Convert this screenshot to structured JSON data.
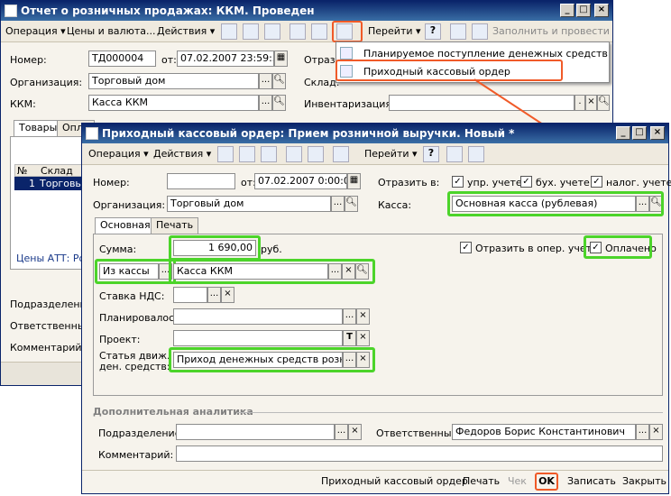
{
  "back": {
    "title": "Отчет о розничных продажах: ККМ. Проведен",
    "toolbar": {
      "operation": "Операция",
      "prices": "Цены и валюта...",
      "actions": "Действия",
      "goto": "Перейти",
      "fill": "Заполнить и провести"
    },
    "number_label": "Номер:",
    "number": "ТД000004",
    "from_label": "от:",
    "date": "07.02.2007 23:59:59",
    "org_label": "Организация:",
    "org": "Торговый дом",
    "kkm_label": "ККМ:",
    "kkm": "Касса ККМ",
    "reflect_label": "Отрази",
    "warehouse_label": "Склад:",
    "inventory_label": "Инвентаризация:",
    "tabs": [
      "Товары",
      "Опла"
    ],
    "col_no": "№",
    "col_wh": "Склад",
    "row_no": "1",
    "row_wh": "Торговы",
    "prices_att": "Цены АТТ: Розн",
    "dept_label": "Подразделение",
    "resp_label": "Ответственный",
    "comment_label": "Комментарий:"
  },
  "menu": {
    "items": [
      "Планируемое поступление денежных средств",
      "Приходный кассовый ордер"
    ]
  },
  "front": {
    "title": "Приходный кассовый ордер: Прием розничной выручки. Новый *",
    "toolbar": {
      "operation": "Операция",
      "actions": "Действия",
      "goto": "Перейти"
    },
    "number_label": "Номер:",
    "from_label": "от:",
    "date": "07.02.2007  0:00:00",
    "reflect_label": "Отразить в:",
    "chk_mgmt": "упр. учете",
    "chk_acc": "бух. учете",
    "chk_tax": "налог. учете",
    "org_label": "Организация:",
    "org": "Торговый дом",
    "cash_label": "Касса:",
    "cash": "Основная касса (рублевая)",
    "tabs": [
      "Основная",
      "Печать"
    ],
    "sum_label": "Сумма:",
    "sum": "1 690,00",
    "currency": "руб.",
    "oper_label": "Отразить в опер. учете",
    "paid_label": "Оплачено",
    "from_kassa": "Из кассы",
    "kassa_kkm": "Касса ККМ",
    "vat_label": "Ставка НДС:",
    "planned_label": "Планировалось:",
    "project_label": "Проект:",
    "cf_label1": "Статья движ.",
    "cf_label2": "ден. средств:",
    "cf": "Приход денежных средств рознични",
    "extra_header": "Дополнительная аналитика",
    "dept_label": "Подразделение:",
    "resp_label": "Ответственный:",
    "resp": "Федоров Борис Константинович",
    "comment_label": "Комментарий:",
    "bottom": {
      "pko": "Приходный кассовый ордер",
      "print": "Печать",
      "check": "Чек",
      "ok": "OK",
      "save": "Записать",
      "close": "Закрыть"
    }
  }
}
